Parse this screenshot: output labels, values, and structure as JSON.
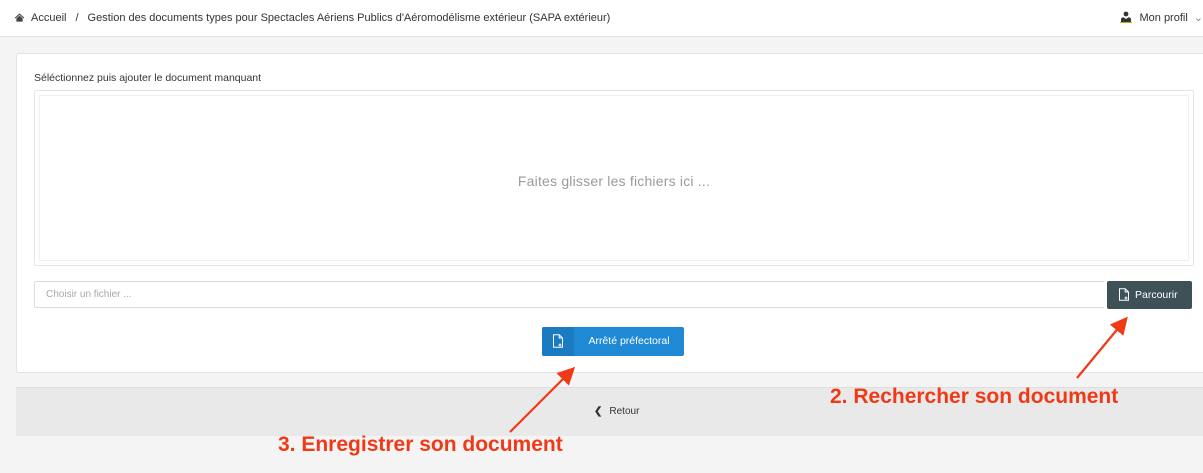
{
  "breadcrumb": {
    "home_icon": "home-icon",
    "home_label": "Accueil",
    "separator": "/",
    "current": "Gestion des documents types pour Spectacles Aériens Publics d'Aéromodélisme extérieur (SAPA extérieur)"
  },
  "profile": {
    "icon": "user-icon",
    "label": "Mon profil"
  },
  "upload": {
    "title": "Séléctionnez puis ajouter le document manquant",
    "dropzone_text": "Faites glisser les fichiers ici ...",
    "file_placeholder": "Choisir un fichier ...",
    "file_value": "",
    "browse_label": "Parcourir",
    "browse_icon": "file-plus-icon",
    "save_label": "Arrêté préfectoral",
    "save_icon": "file-plus-icon"
  },
  "footer": {
    "back_label": "Retour",
    "back_icon": "chevron-left-icon"
  },
  "annotations": {
    "step2": "2. Rechercher son document",
    "step3": "3. Enregistrer son document",
    "color": "#f03a17"
  },
  "colors": {
    "primary": "#1f89d6",
    "dark": "#3e5157"
  }
}
